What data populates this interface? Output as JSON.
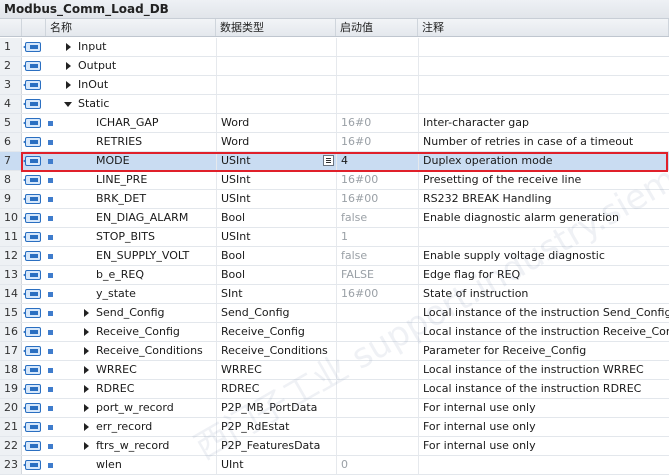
{
  "window": {
    "title": "Modbus_Comm_Load_DB"
  },
  "columns": {
    "name": "名称",
    "type": "数据类型",
    "start": "启动值",
    "comment": "注释"
  },
  "rows": [
    {
      "num": "1",
      "name": "Input",
      "type": "",
      "start": "",
      "comment": "",
      "expander": "right",
      "indent": 0,
      "square": false
    },
    {
      "num": "2",
      "name": "Output",
      "type": "",
      "start": "",
      "comment": "",
      "expander": "right",
      "indent": 0,
      "square": false
    },
    {
      "num": "3",
      "name": "InOut",
      "type": "",
      "start": "",
      "comment": "",
      "expander": "right",
      "indent": 0,
      "square": false
    },
    {
      "num": "4",
      "name": "Static",
      "type": "",
      "start": "",
      "comment": "",
      "expander": "down",
      "indent": 0,
      "square": false
    },
    {
      "num": "5",
      "name": "ICHAR_GAP",
      "type": "Word",
      "start": "16#0",
      "comment": "Inter-character gap",
      "expander": "none",
      "indent": 1,
      "square": true
    },
    {
      "num": "6",
      "name": "RETRIES",
      "type": "Word",
      "start": "16#0",
      "comment": "Number of retries in case of a timeout",
      "expander": "none",
      "indent": 1,
      "square": true
    },
    {
      "num": "7",
      "name": "MODE",
      "type": "USInt",
      "start": "4",
      "comment": "Duplex operation mode",
      "expander": "none",
      "indent": 1,
      "square": true,
      "selected": true
    },
    {
      "num": "8",
      "name": "LINE_PRE",
      "type": "USInt",
      "start": "16#00",
      "comment": "Presetting of the receive line",
      "expander": "none",
      "indent": 1,
      "square": true
    },
    {
      "num": "9",
      "name": "BRK_DET",
      "type": "USInt",
      "start": "16#00",
      "comment": "RS232 BREAK Handling",
      "expander": "none",
      "indent": 1,
      "square": true
    },
    {
      "num": "10",
      "name": "EN_DIAG_ALARM",
      "type": "Bool",
      "start": "false",
      "comment": "Enable diagnostic alarm generation",
      "expander": "none",
      "indent": 1,
      "square": true
    },
    {
      "num": "11",
      "name": "STOP_BITS",
      "type": "USInt",
      "start": "1",
      "comment": "",
      "expander": "none",
      "indent": 1,
      "square": true
    },
    {
      "num": "12",
      "name": "EN_SUPPLY_VOLT",
      "type": "Bool",
      "start": "false",
      "comment": "Enable supply voltage diagnostic",
      "expander": "none",
      "indent": 1,
      "square": true
    },
    {
      "num": "13",
      "name": "b_e_REQ",
      "type": "Bool",
      "start": "FALSE",
      "comment": "Edge flag for REQ",
      "expander": "none",
      "indent": 1,
      "square": true
    },
    {
      "num": "14",
      "name": "y_state",
      "type": "SInt",
      "start": "16#00",
      "comment": "State of instruction",
      "expander": "none",
      "indent": 1,
      "square": true
    },
    {
      "num": "15",
      "name": "Send_Config",
      "type": "Send_Config",
      "start": "",
      "comment": "Local instance of the instruction Send_Config",
      "expander": "right",
      "indent": 1,
      "square": true
    },
    {
      "num": "16",
      "name": "Receive_Config",
      "type": "Receive_Config",
      "start": "",
      "comment": "Local instance of the instruction Receive_Config",
      "expander": "right",
      "indent": 1,
      "square": true
    },
    {
      "num": "17",
      "name": "Receive_Conditions",
      "type": "Receive_Conditions",
      "start": "",
      "comment": "Parameter for Receive_Config",
      "expander": "right",
      "indent": 1,
      "square": true
    },
    {
      "num": "18",
      "name": "WRREC",
      "type": "WRREC",
      "start": "",
      "comment": "Local instance of the instruction WRREC",
      "expander": "right",
      "indent": 1,
      "square": true
    },
    {
      "num": "19",
      "name": "RDREC",
      "type": "RDREC",
      "start": "",
      "comment": "Local instance of the instruction RDREC",
      "expander": "right",
      "indent": 1,
      "square": true
    },
    {
      "num": "20",
      "name": "port_w_record",
      "type": "P2P_MB_PortData",
      "start": "",
      "comment": "For internal use only",
      "expander": "right",
      "indent": 1,
      "square": true
    },
    {
      "num": "21",
      "name": "err_record",
      "type": "P2P_RdEstat",
      "start": "",
      "comment": "For internal use only",
      "expander": "right",
      "indent": 1,
      "square": true
    },
    {
      "num": "22",
      "name": "ftrs_w_record",
      "type": "P2P_FeaturesData",
      "start": "",
      "comment": "For internal use only",
      "expander": "right",
      "indent": 1,
      "square": true
    },
    {
      "num": "23",
      "name": "wlen",
      "type": "UInt",
      "start": "0",
      "comment": "",
      "expander": "none",
      "indent": 1,
      "square": true
    }
  ],
  "watermark": "西门子工业 support.industry.siemens.com"
}
